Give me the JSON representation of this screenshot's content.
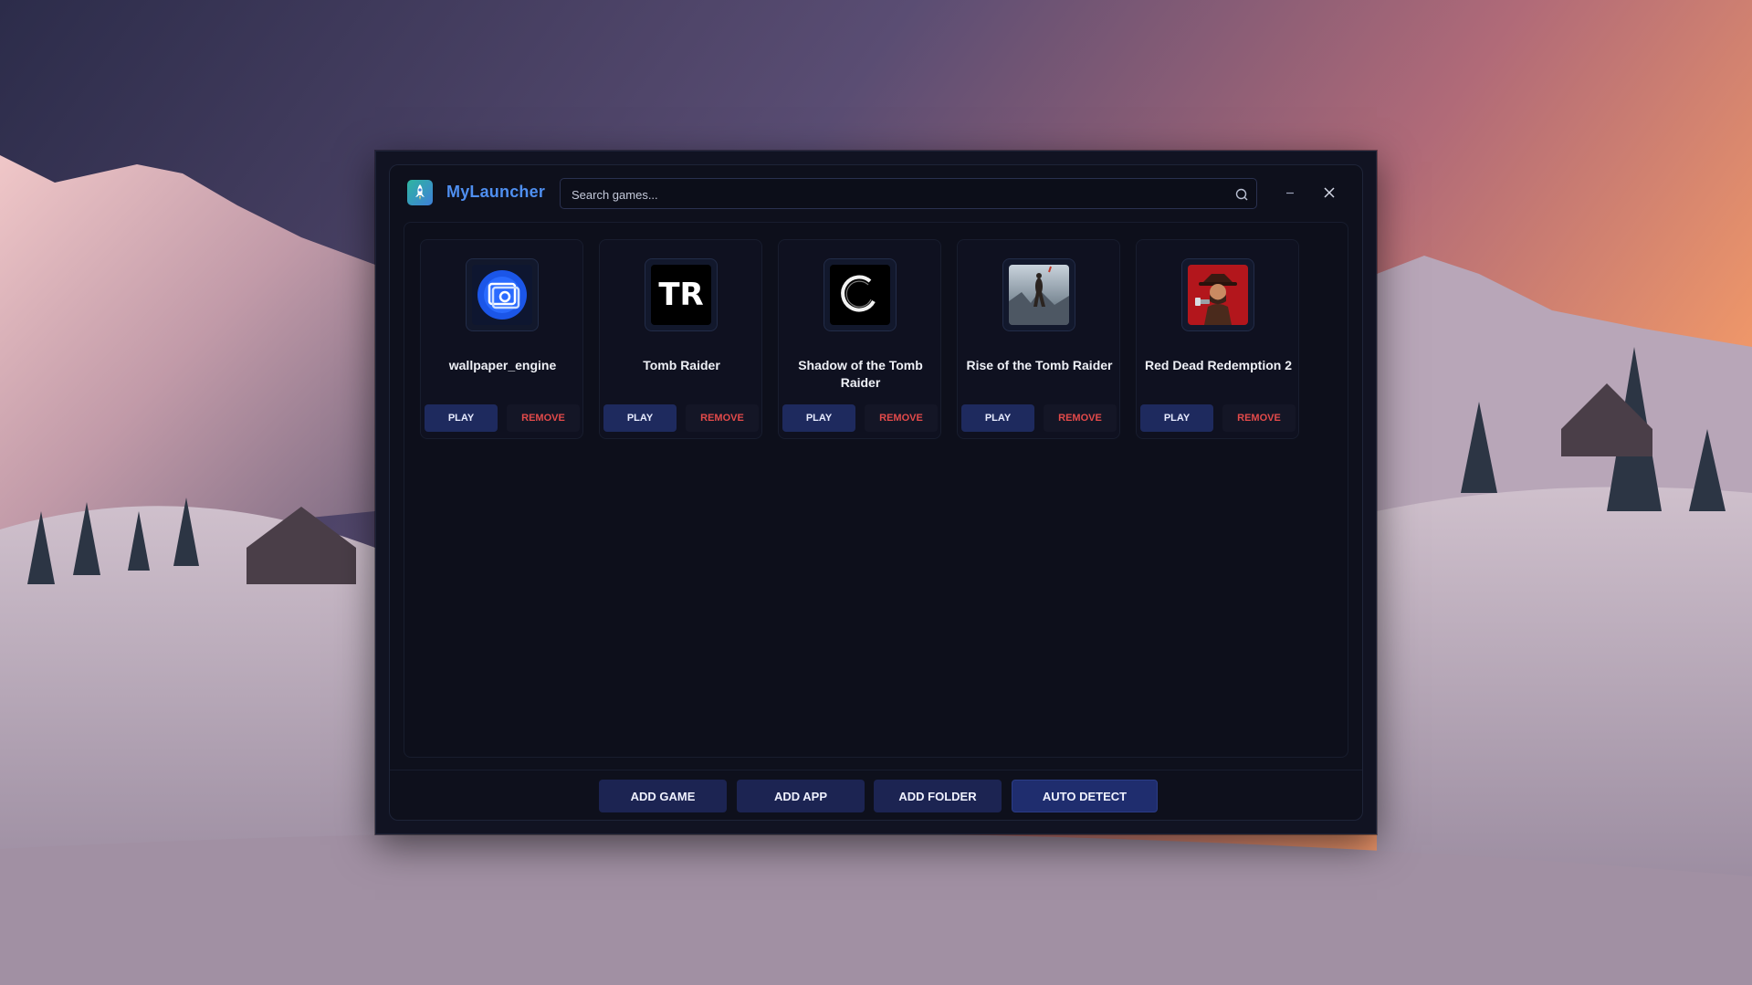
{
  "app": {
    "title": "MyLauncher",
    "logo_icon": "rocket-icon"
  },
  "search": {
    "placeholder": "Search games...",
    "icon": "search-icon"
  },
  "window_controls": {
    "minimize_icon": "minimize-icon",
    "close_icon": "close-icon"
  },
  "games": [
    {
      "name": "wallpaper_engine",
      "icon": "wallpaper-engine-icon",
      "play_label": "PLAY",
      "remove_label": "REMOVE"
    },
    {
      "name": "Tomb Raider",
      "icon": "tomb-raider-icon",
      "icon_text": "TR",
      "play_label": "PLAY",
      "remove_label": "REMOVE"
    },
    {
      "name": "Shadow of the Tomb Raider",
      "icon": "shadow-of-the-tomb-raider-icon",
      "play_label": "PLAY",
      "remove_label": "REMOVE"
    },
    {
      "name": "Rise of the Tomb Raider",
      "icon": "rise-of-the-tomb-raider-icon",
      "play_label": "PLAY",
      "remove_label": "REMOVE"
    },
    {
      "name": "Red Dead Redemption 2",
      "icon": "red-dead-redemption-2-icon",
      "play_label": "PLAY",
      "remove_label": "REMOVE"
    }
  ],
  "footer": {
    "add_game": "ADD GAME",
    "add_app": "ADD APP",
    "add_folder": "ADD FOLDER",
    "auto_detect": "AUTO DETECT"
  },
  "colors": {
    "accent": "#4f8ff0",
    "play_button": "#1e2a5e",
    "remove_text": "#e24a4a",
    "window_bg": "#0e101c"
  }
}
